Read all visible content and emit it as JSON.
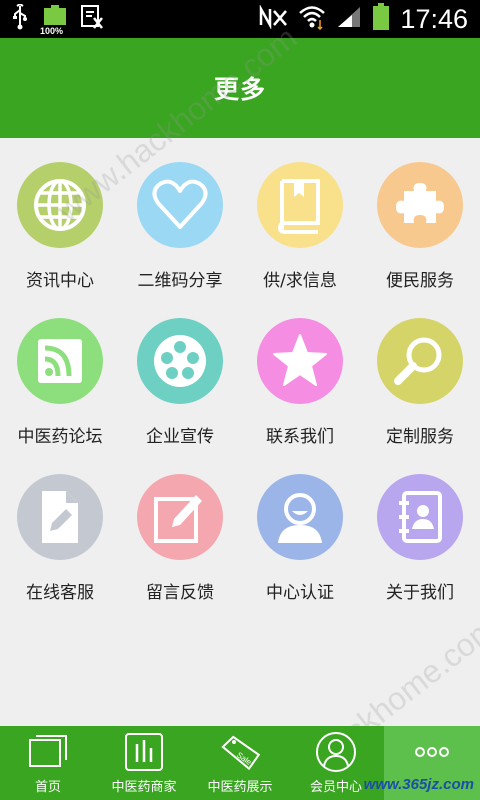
{
  "status_bar": {
    "time": "17:46",
    "battery_badge": "100%"
  },
  "header": {
    "title": "更多"
  },
  "grid": {
    "items": [
      {
        "label": "资讯中心",
        "icon": "globe-icon",
        "color": "#b5cf6b"
      },
      {
        "label": "二维码分享",
        "icon": "heart-icon",
        "color": "#9ad8f4"
      },
      {
        "label": "供/求信息",
        "icon": "book-icon",
        "color": "#f9e08a"
      },
      {
        "label": "便民服务",
        "icon": "puzzle-icon",
        "color": "#f8c98e"
      },
      {
        "label": "中医药论坛",
        "icon": "rss-icon",
        "color": "#8ddf7e"
      },
      {
        "label": "企业宣传",
        "icon": "film-reel-icon",
        "color": "#6ed0c3"
      },
      {
        "label": "联系我们",
        "icon": "star-icon",
        "color": "#f58ee3"
      },
      {
        "label": "定制服务",
        "icon": "magnifier-icon",
        "color": "#d5d468"
      },
      {
        "label": "在线客服",
        "icon": "document-edit-icon",
        "color": "#c4c9d1"
      },
      {
        "label": "留言反馈",
        "icon": "note-pen-icon",
        "color": "#f4a7ae"
      },
      {
        "label": "中心认证",
        "icon": "user-icon",
        "color": "#9bb5e8"
      },
      {
        "label": "关于我们",
        "icon": "contact-book-icon",
        "color": "#b8a6ef"
      }
    ]
  },
  "bottom_nav": {
    "tabs": [
      {
        "label": "首页",
        "icon": "home-stack-icon"
      },
      {
        "label": "中医药商家",
        "icon": "bar-chart-icon"
      },
      {
        "label": "中医药展示",
        "icon": "sale-tag-icon"
      },
      {
        "label": "会员中心",
        "icon": "member-icon"
      },
      {
        "label": "",
        "icon": "more-dots-icon"
      }
    ]
  },
  "watermarks": {
    "top": "www.hackhome.com",
    "bottom": "www.hackhome.com",
    "site": "www.365jz.com"
  },
  "colors": {
    "primary_green": "#3aa521",
    "active_tab": "#5dbf4c",
    "background": "#efefef"
  }
}
